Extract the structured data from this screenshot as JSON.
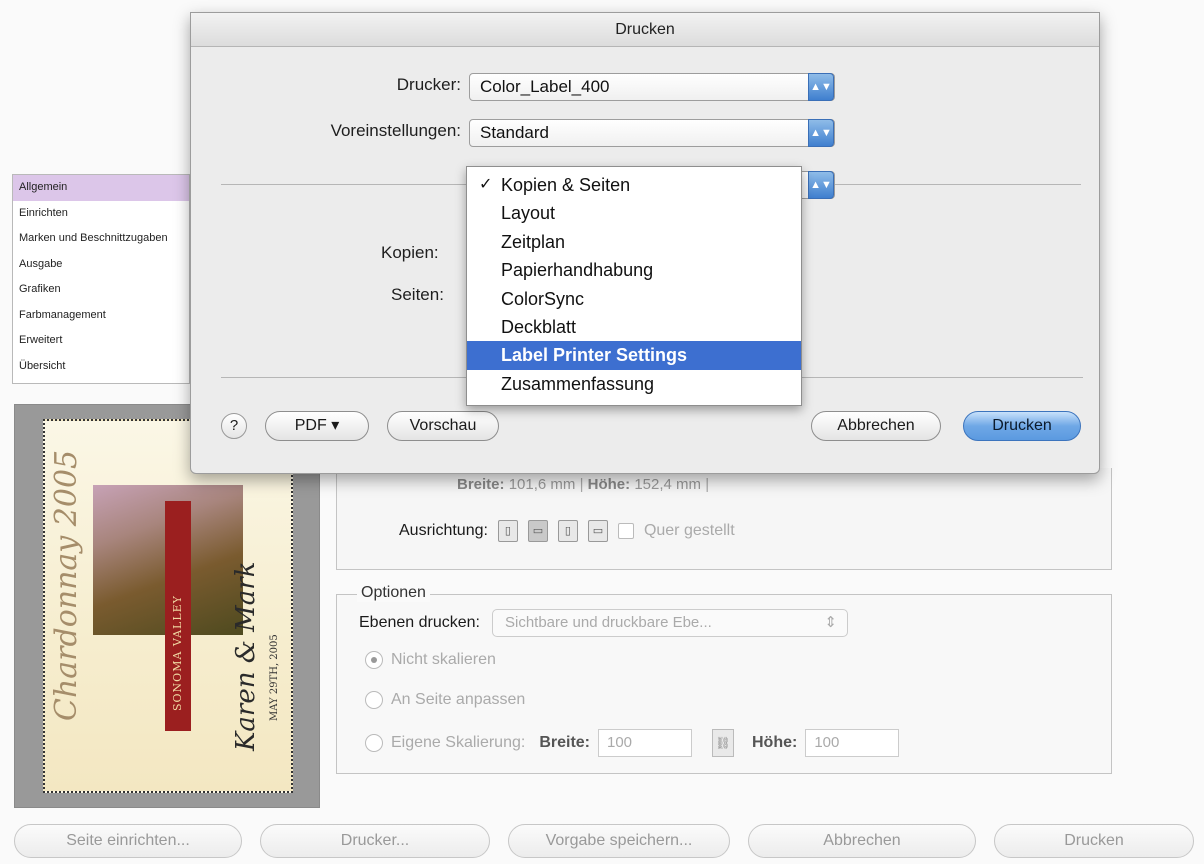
{
  "sheet": {
    "title": "Drucken",
    "printer_label": "Drucker:",
    "printer_value": "Color_Label_400",
    "presets_label": "Voreinstellungen:",
    "presets_value": "Standard",
    "copies_label": "Kopien:",
    "pages_label": "Seiten:",
    "help_label": "?",
    "pdf_label": "PDF ▾",
    "preview_label": "Vorschau",
    "cancel_label": "Abbrechen",
    "print_label": "Drucken",
    "popup_arrow_icon": "up-down-arrows-icon"
  },
  "menu": {
    "items": [
      {
        "label": "Kopien & Seiten",
        "checked": true,
        "highlighted": false
      },
      {
        "label": "Layout",
        "checked": false,
        "highlighted": false
      },
      {
        "label": "Zeitplan",
        "checked": false,
        "highlighted": false
      },
      {
        "label": "Papierhandhabung",
        "checked": false,
        "highlighted": false
      },
      {
        "label": "ColorSync",
        "checked": false,
        "highlighted": false
      },
      {
        "label": "Deckblatt",
        "checked": false,
        "highlighted": false
      },
      {
        "label": "Label Printer Settings",
        "checked": false,
        "highlighted": true
      },
      {
        "label": "Zusammenfassung",
        "checked": false,
        "highlighted": false
      }
    ],
    "check_glyph": "✓"
  },
  "sidebar": {
    "items": [
      {
        "label": "Allgemein",
        "selected": true
      },
      {
        "label": "Einrichten",
        "selected": false
      },
      {
        "label": "Marken und Beschnittzugaben",
        "selected": false
      },
      {
        "label": "Ausgabe",
        "selected": false
      },
      {
        "label": "Grafiken",
        "selected": false
      },
      {
        "label": "Farbmanagement",
        "selected": false
      },
      {
        "label": "Erweitert",
        "selected": false
      },
      {
        "label": "Übersicht",
        "selected": false
      }
    ]
  },
  "preview": {
    "title_text": "Chardonnay 2005",
    "names_text": "Karen & Mark",
    "date_text": "MAY 29TH, 2005",
    "stripe_text": "SONOMA VALLEY"
  },
  "setup": {
    "width_label": "Breite:",
    "width_value": "101,6 mm",
    "height_label": "Höhe:",
    "height_value": "152,4 mm",
    "orientation_label": "Ausrichtung:",
    "landscape_label": "Quer gestellt"
  },
  "options": {
    "legend": "Optionen",
    "layers_label": "Ebenen drucken:",
    "layers_value": "Sichtbare und druckbare Ebe...",
    "radio_no_scale": "Nicht skalieren",
    "radio_fit": "An Seite anpassen",
    "radio_custom": "Eigene Skalierung:",
    "scale_width_label": "Breite:",
    "scale_width_value": "100",
    "scale_height_label": "Höhe:",
    "scale_height_value": "100"
  },
  "bottom_bar": {
    "page_setup": "Seite einrichten...",
    "printer": "Drucker...",
    "save_preset": "Vorgabe speichern...",
    "cancel": "Abbrechen",
    "print": "Drucken"
  },
  "colors": {
    "menu_highlight": "#3d6fd0",
    "default_button": "#5b9ae0",
    "sidebar_selected": "#dcc6e9"
  }
}
